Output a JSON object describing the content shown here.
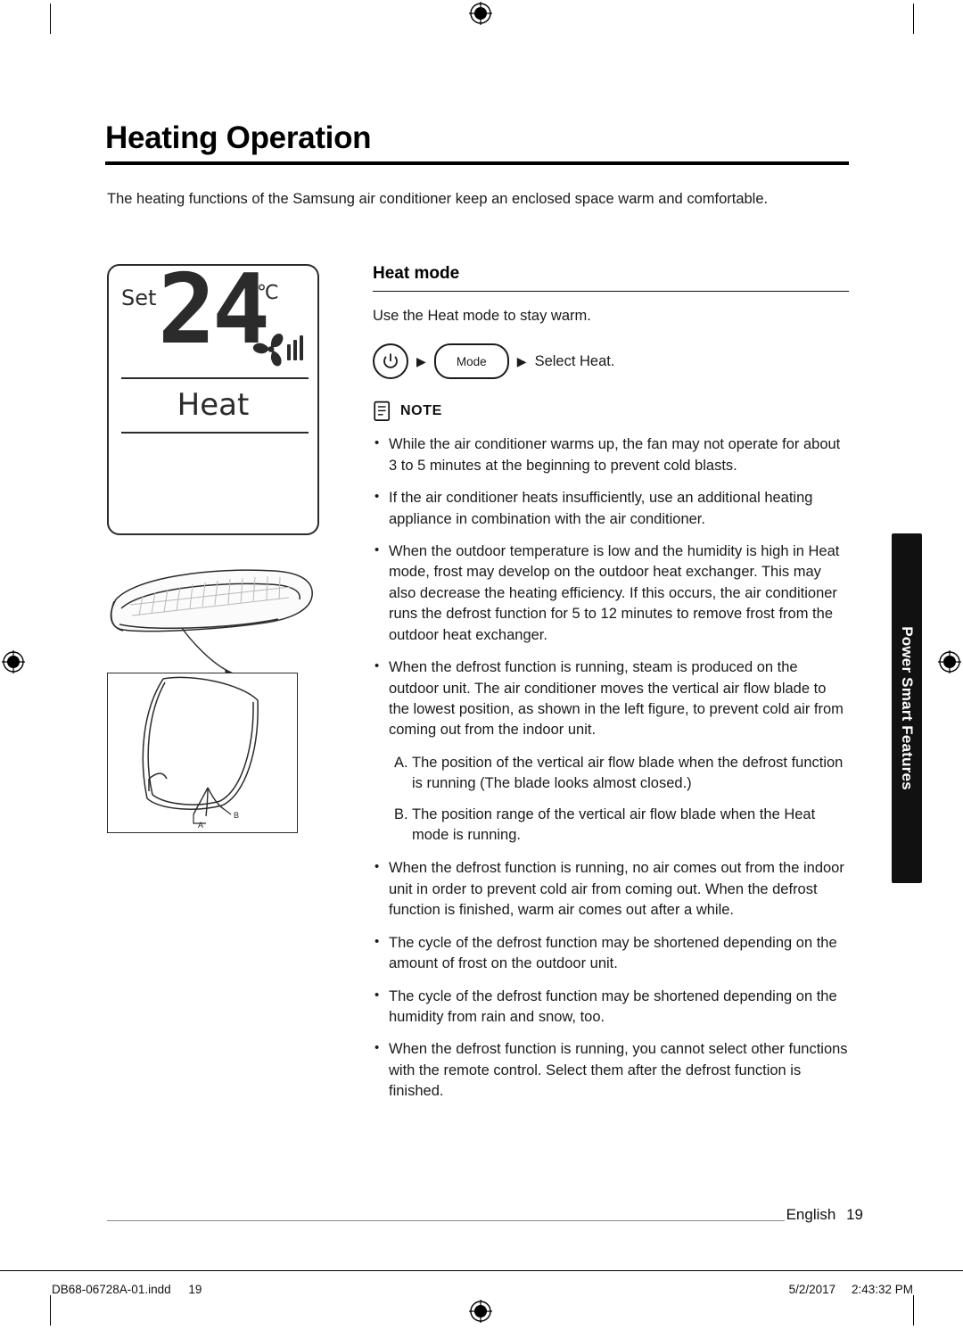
{
  "document": {
    "title": "Heating Operation",
    "intro": "The heating functions of the Samsung air conditioner keep an enclosed space warm and comfortable."
  },
  "display_panel": {
    "set_label": "Set",
    "temperature": "24",
    "unit": "℃",
    "mode": "Heat",
    "fan_icon": "fan-icon"
  },
  "figure": {
    "unit_icon": "indoor-unit-illustration",
    "blade_icon": "air-flow-blade-diagram",
    "label_a": "A",
    "label_b": "B"
  },
  "section": {
    "heading": "Heat mode",
    "subtext": "Use the Heat mode to stay warm.",
    "steps": {
      "power_icon": "power-button-icon",
      "arrow1": "▶",
      "mode_button": "Mode",
      "arrow2": "▶",
      "result": "Select Heat."
    },
    "note": {
      "icon": "note-document-icon",
      "label": "NOTE",
      "bullets": [
        "While the air conditioner warms up, the fan may not operate for about 3 to 5 minutes at the beginning to prevent cold blasts.",
        "If the air conditioner heats insufficiently, use an additional heating appliance in combination with the air conditioner.",
        "When the outdoor temperature is low and the humidity is high in Heat mode, frost may develop on the outdoor heat exchanger. This may also decrease the heating efficiency. If this occurs, the air conditioner runs the defrost function for 5 to 12 minutes to remove frost from the outdoor heat exchanger.",
        "When the defrost function is running, steam is produced on the outdoor unit. The air conditioner moves the vertical air flow blade to the lowest position, as shown in the left figure, to prevent cold air from coming out from the indoor unit."
      ],
      "sublist": [
        {
          "label": "A.",
          "text": "The position of the vertical air flow blade when the defrost function is running (The blade looks almost closed.)"
        },
        {
          "label": "B.",
          "text": "The position range of the vertical air flow blade when the Heat mode is running."
        }
      ],
      "bullets2": [
        "When the defrost function is running, no air comes out from the indoor unit in order to prevent cold air from coming out. When the defrost function is finished, warm air comes out after a while.",
        "The cycle of the defrost function may be shortened depending on the amount of frost on the outdoor unit.",
        "The cycle of the defrost function may be shortened depending on the humidity from rain and snow, too.",
        "When the defrost function is running, you cannot select other functions with the remote control. Select them after the defrost function is finished."
      ]
    }
  },
  "side_tab": {
    "label": "Power Smart Features"
  },
  "footer": {
    "language": "English",
    "page_number": "19"
  },
  "print_marks": {
    "file_name": "DB68-06728A-01.indd",
    "page": "19",
    "date": "5/2/2017",
    "time": "2:43:32 PM"
  },
  "colors": {
    "text": "#1a1a1a",
    "rule": "#000000",
    "tab_bg": "#111111",
    "tab_text": "#ffffff"
  }
}
